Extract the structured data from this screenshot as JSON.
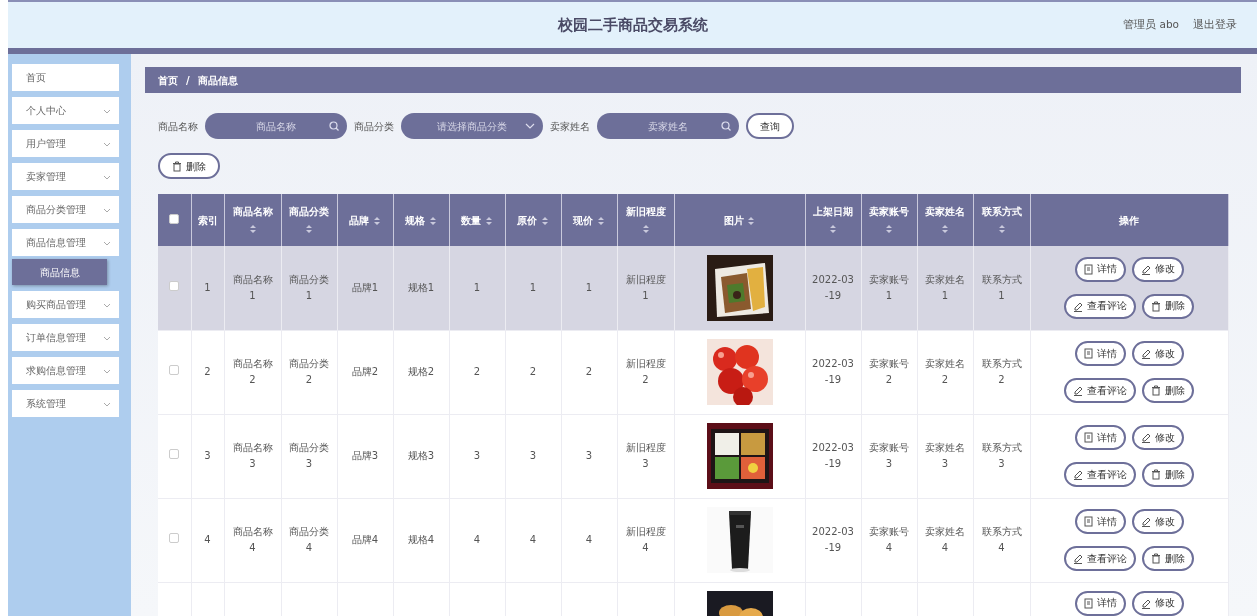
{
  "header": {
    "title": "校园二手商品交易系统",
    "user": "管理员 abo",
    "logout": "退出登录"
  },
  "sidebar": {
    "items": [
      {
        "label": "首页",
        "expandable": false
      },
      {
        "label": "个人中心",
        "expandable": true
      },
      {
        "label": "用户管理",
        "expandable": true
      },
      {
        "label": "卖家管理",
        "expandable": true
      },
      {
        "label": "商品分类管理",
        "expandable": true
      },
      {
        "label": "商品信息管理",
        "expandable": true,
        "children": [
          {
            "label": "商品信息",
            "selected": true
          }
        ]
      },
      {
        "label": "购买商品管理",
        "expandable": true
      },
      {
        "label": "订单信息管理",
        "expandable": true
      },
      {
        "label": "求购信息管理",
        "expandable": true
      },
      {
        "label": "系统管理",
        "expandable": true
      }
    ]
  },
  "breadcrumb": [
    "首页",
    "商品信息"
  ],
  "breadcrumb_separator": "/",
  "search": {
    "fields": [
      {
        "label": "商品名称",
        "placeholder": "商品名称",
        "kind": "text"
      },
      {
        "label": "商品分类",
        "placeholder": "请选择商品分类",
        "kind": "select"
      },
      {
        "label": "卖家姓名",
        "placeholder": "卖家姓名",
        "kind": "text"
      }
    ],
    "button": "查询"
  },
  "delete_button": "删除",
  "table": {
    "select_all_checked": false,
    "columns": [
      {
        "label": "索引",
        "sortable": false
      },
      {
        "label": "商品名称",
        "sortable": true
      },
      {
        "label": "商品分类",
        "sortable": true
      },
      {
        "label": "品牌",
        "sortable": true
      },
      {
        "label": "规格",
        "sortable": true
      },
      {
        "label": "数量",
        "sortable": true
      },
      {
        "label": "原价",
        "sortable": true
      },
      {
        "label": "现价",
        "sortable": true
      },
      {
        "label": "新旧程度",
        "sortable": true
      },
      {
        "label": "图片",
        "sortable": true
      },
      {
        "label": "上架日期",
        "sortable": true
      },
      {
        "label": "卖家账号",
        "sortable": true
      },
      {
        "label": "卖家姓名",
        "sortable": true
      },
      {
        "label": "联系方式",
        "sortable": true
      },
      {
        "label": "操作",
        "sortable": false
      }
    ],
    "rows": [
      {
        "highlighted": true,
        "checked": false,
        "cells": [
          "1",
          "商品名称1",
          "商品分类1",
          "品牌1",
          "规格1",
          "1",
          "1",
          "1",
          "新旧程度1",
          null,
          "2022-03-19",
          "卖家账号1",
          "卖家姓名1",
          "联系方式1"
        ],
        "picture": {
          "kind": "picture"
        },
        "actions": [
          {
            "label": "详情"
          },
          {
            "label": "修改"
          },
          {
            "label": "查看评论"
          },
          {
            "label": "删除"
          }
        ]
      },
      {
        "highlighted": false,
        "checked": false,
        "cells": [
          "2",
          "商品名称2",
          "商品分类2",
          "品牌2",
          "规格2",
          "2",
          "2",
          "2",
          "新旧程度2",
          null,
          "2022-03-19",
          "卖家账号2",
          "卖家姓名2",
          "联系方式2"
        ],
        "picture": {
          "kind": "picture"
        },
        "actions": [
          {
            "label": "详情"
          },
          {
            "label": "修改"
          },
          {
            "label": "查看评论"
          },
          {
            "label": "删除"
          }
        ]
      },
      {
        "highlighted": false,
        "checked": false,
        "cells": [
          "3",
          "商品名称3",
          "商品分类3",
          "品牌3",
          "规格3",
          "3",
          "3",
          "3",
          "新旧程度3",
          null,
          "2022-03-19",
          "卖家账号3",
          "卖家姓名3",
          "联系方式3"
        ],
        "picture": {
          "kind": "picture"
        },
        "actions": [
          {
            "label": "详情"
          },
          {
            "label": "修改"
          },
          {
            "label": "查看评论"
          },
          {
            "label": "删除"
          }
        ]
      },
      {
        "highlighted": false,
        "checked": false,
        "cells": [
          "4",
          "商品名称4",
          "商品分类4",
          "品牌4",
          "规格4",
          "4",
          "4",
          "4",
          "新旧程度4",
          null,
          "2022-03-19",
          "卖家账号4",
          "卖家姓名4",
          "联系方式4"
        ],
        "picture": {
          "kind": "picture"
        },
        "actions": [
          {
            "label": "详情"
          },
          {
            "label": "修改"
          },
          {
            "label": "查看评论"
          },
          {
            "label": "删除"
          }
        ]
      },
      {
        "highlighted": false,
        "partial": true,
        "picture": {
          "kind": "picture"
        },
        "actions": [
          {
            "label": "详情"
          },
          {
            "label": "修改"
          }
        ]
      }
    ]
  }
}
